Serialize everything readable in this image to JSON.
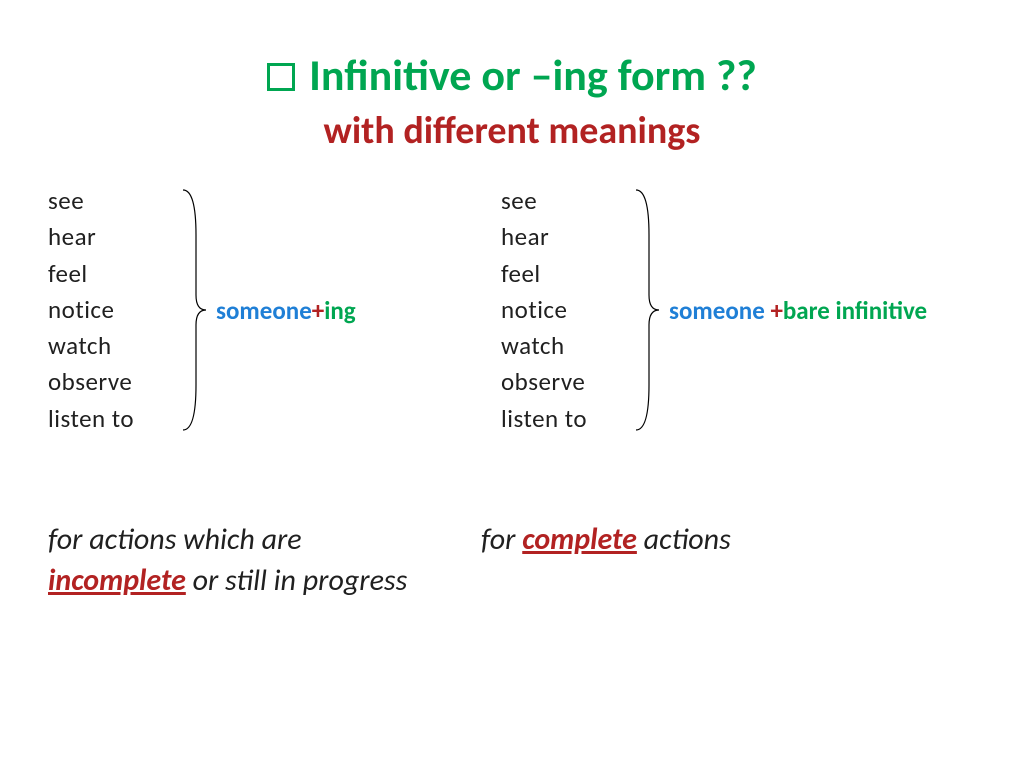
{
  "header": {
    "title": "Infinitive or –ing form ??",
    "subtitle": "with different meanings"
  },
  "verbs": {
    "v0": "see",
    "v1": "hear",
    "v2": "feel",
    "v3": "notice",
    "v4": "watch",
    "v5": "observe",
    "v6": "listen to"
  },
  "left": {
    "pattern_prefix": "someone",
    "pattern_plus": "+",
    "pattern_tail": "ing",
    "explain_pre": "for actions which are ",
    "explain_hl": "incomplete",
    "explain_post": " or still in progress"
  },
  "right": {
    "pattern_prefix": "someone ",
    "pattern_plus": "+",
    "pattern_tail": "bare infinitive",
    "explain_pre": "for ",
    "explain_hl": "complete",
    "explain_post": " actions"
  }
}
